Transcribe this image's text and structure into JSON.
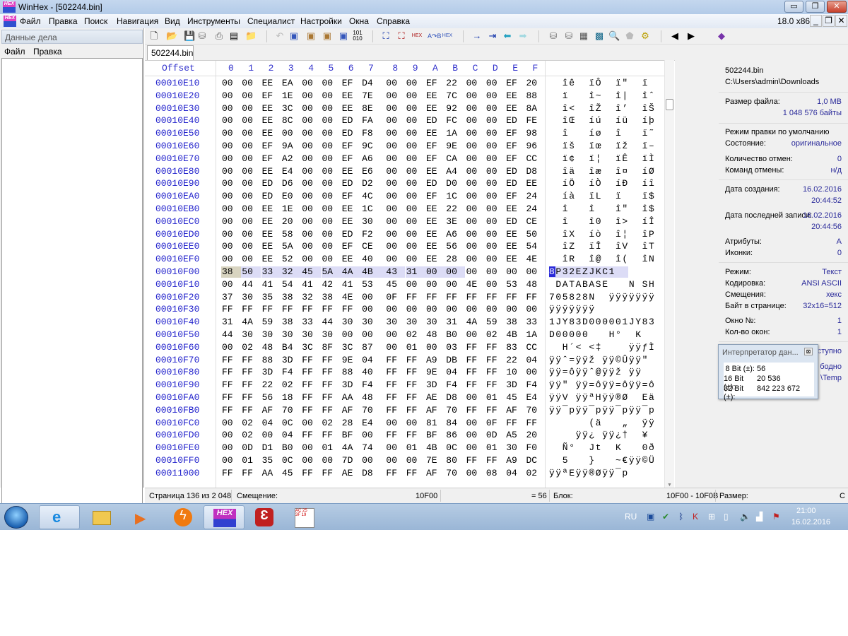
{
  "window": {
    "title": "WinHex - [502244.bin]",
    "version": "18.0 x86"
  },
  "menu": [
    "Файл",
    "Правка",
    "Поиск",
    "Навигация",
    "Вид",
    "Инструменты",
    "Специалист",
    "Настройки",
    "Окна",
    "Справка"
  ],
  "left_panel": {
    "title": "Данные дела",
    "menu": [
      "Файл",
      "Правка"
    ]
  },
  "tab": "502244.bin",
  "hex": {
    "offset_header": "Offset",
    "columns": [
      "0",
      "1",
      "2",
      "3",
      "4",
      "5",
      "6",
      "7",
      "8",
      "9",
      "A",
      "B",
      "C",
      "D",
      "E",
      "F"
    ],
    "rows": [
      {
        "o": "00010E10",
        "h": "00 00 EE EA 00 00 EF D4 00 00 EF 22 00 00 EF 20",
        "t": "  îê  ïÔ  ï\"  ï "
      },
      {
        "o": "00010E20",
        "h": "00 00 EF 1E 00 00 EE 7E 00 00 EE 7C 00 00 EE 88",
        "t": "  ï   î~  î|  îˆ"
      },
      {
        "o": "00010E30",
        "h": "00 00 EE 3C 00 00 EE 8E 00 00 EE 92 00 00 EE 8A",
        "t": "  î<  îŽ  î’  îŠ"
      },
      {
        "o": "00010E40",
        "h": "00 00 EE 8C 00 00 ED FA 00 00 ED FC 00 00 ED FE",
        "t": "  îŒ  íú  íü  íþ"
      },
      {
        "o": "00010E50",
        "h": "00 00 EE 00 00 00 ED F8 00 00 EE 1A 00 00 EF 98",
        "t": "  î   íø  î   ï˜"
      },
      {
        "o": "00010E60",
        "h": "00 00 EF 9A 00 00 EF 9C 00 00 EF 9E 00 00 EF 96",
        "t": "  ïš  ïœ  ïž  ï–"
      },
      {
        "o": "00010E70",
        "h": "00 00 EF A2 00 00 EF A6 00 00 EF CA 00 00 EF CC",
        "t": "  ï¢  ï¦  ïÊ  ïÌ"
      },
      {
        "o": "00010E80",
        "h": "00 00 EE E4 00 00 EE E6 00 00 EE A4 00 00 ED D8",
        "t": "  îä  îæ  î¤  íØ"
      },
      {
        "o": "00010E90",
        "h": "00 00 ED D6 00 00 ED D2 00 00 ED D0 00 00 ED EE",
        "t": "  íÖ  íÒ  íÐ  íî"
      },
      {
        "o": "00010EA0",
        "h": "00 00 ED E0 00 00 EF 4C 00 00 EF 1C 00 00 EF 24",
        "t": "  íà  ïL  ï   ï$"
      },
      {
        "o": "00010EB0",
        "h": "00 00 EE 1E 00 00 EE 1C 00 00 EE 22 00 00 EE 24",
        "t": "  î   î   î\"  î$"
      },
      {
        "o": "00010EC0",
        "h": "00 00 EE 20 00 00 EE 30 00 00 EE 3E 00 00 ED CE",
        "t": "  î   î0  î>  íÎ"
      },
      {
        "o": "00010ED0",
        "h": "00 00 EE 58 00 00 ED F2 00 00 EE A6 00 00 EE 50",
        "t": "  îX  íò  î¦  îP"
      },
      {
        "o": "00010EE0",
        "h": "00 00 EE 5A 00 00 EF CE 00 00 EE 56 00 00 EE 54",
        "t": "  îZ  ïÎ  îV  îT"
      },
      {
        "o": "00010EF0",
        "h": "00 00 EE 52 00 00 EE 40 00 00 EE 28 00 00 EE 4E",
        "t": "  îR  î@  î(  îN"
      },
      {
        "o": "00010F00",
        "h": "38 50 33 32 45 5A 4A 4B 43 31 00 00 00 00 00 00",
        "t": "8P32EZJKC1      "
      },
      {
        "o": "00010F10",
        "h": "00 44 41 54 41 42 41 53 45 00 00 00 4E 00 53 48",
        "t": " DATABASE   N SH"
      },
      {
        "o": "00010F20",
        "h": "37 30 35 38 32 38 4E 00 0F FF FF FF FF FF FF FF",
        "t": "705828N  ÿÿÿÿÿÿÿ"
      },
      {
        "o": "00010F30",
        "h": "FF FF FF FF FF FF FF 00 00 00 00 00 00 00 00 00",
        "t": "ÿÿÿÿÿÿÿ         "
      },
      {
        "o": "00010F40",
        "h": "31 4A 59 38 33 44 30 30 30 30 30 31 4A 59 38 33",
        "t": "1JY83D000001JY83"
      },
      {
        "o": "00010F50",
        "h": "44 30 30 30 30 30 00 00 00 02 48 B0 00 02 4B 1A",
        "t": "D00000   H°  K "
      },
      {
        "o": "00010F60",
        "h": "00 02 48 B4 3C 8F 3C 87 00 01 00 03 FF FF 83 CC",
        "t": "  H´< <‡    ÿÿƒÌ"
      },
      {
        "o": "00010F70",
        "h": "FF FF 88 3D FF FF 9E 04 FF FF A9 DB FF FF 22 04",
        "t": "ÿÿˆ=ÿÿž ÿÿ©Ûÿÿ\" "
      },
      {
        "o": "00010F80",
        "h": "FF FF 3D F4 FF FF 88 40 FF FF 9E 04 FF FF 10 00",
        "t": "ÿÿ=ôÿÿˆ@ÿÿž ÿÿ  "
      },
      {
        "o": "00010F90",
        "h": "FF FF 22 02 FF FF 3D F4 FF FF 3D F4 FF FF 3D F4",
        "t": "ÿÿ\" ÿÿ=ôÿÿ=ôÿÿ=ô"
      },
      {
        "o": "00010FA0",
        "h": "FF FF 56 18 FF FF AA 48 FF FF AE D8 00 01 45 E4",
        "t": "ÿÿV ÿÿªHÿÿ®Ø  Eä"
      },
      {
        "o": "00010FB0",
        "h": "FF FF AF 70 FF FF AF 70 FF FF AF 70 FF FF AF 70",
        "t": "ÿÿ¯pÿÿ¯pÿÿ¯pÿÿ¯p"
      },
      {
        "o": "00010FC0",
        "h": "00 02 04 0C 00 02 28 E4 00 00 81 84 00 0F FF FF",
        "t": "      (ä   „  ÿÿ"
      },
      {
        "o": "00010FD0",
        "h": "00 02 00 04 FF FF BF 00 FF FF BF 86 00 0D A5 20",
        "t": "    ÿÿ¿ ÿÿ¿†  ¥ "
      },
      {
        "o": "00010FE0",
        "h": "00 0D D1 B0 00 01 4A 74 00 01 4B 0C 00 01 30 F0",
        "t": "  Ñ°  Jt  K   0ð"
      },
      {
        "o": "00010FF0",
        "h": "00 01 35 0C 00 00 7D 00 00 00 7E 80 FF FF A9 DC",
        "t": "  5   }   ~€ÿÿ©Ü"
      },
      {
        "o": "00011000",
        "h": "FF FF AA 45 FF FF AE D8 FF FF AF 70 00 08 04 02",
        "t": "ÿÿªEÿÿ®Øÿÿ¯p    "
      }
    ],
    "selection": {
      "row_offset": "00010F00",
      "start_byte": 0,
      "length": 12
    }
  },
  "info": {
    "file_name": "502244.bin",
    "path": "C:\\Users\\admin\\Downloads",
    "size_label": "Размер файла:",
    "size_value": "1,0 MB",
    "size_bytes": "1 048 576 байты",
    "edit_mode": "Режим правки по умолчанию",
    "state_label": "Состояние:",
    "state_value": "оригинальное",
    "undo_count_label": "Количество отмен:",
    "undo_count_value": "0",
    "undo_cmd_label": "Команд отмены:",
    "undo_cmd_value": "н/д",
    "created_label": "Дата создания:",
    "created_date": "16.02.2016",
    "created_time": "20:44:52",
    "modified_label": "Дата последней записи:",
    "modified_date": "16.02.2016",
    "modified_time": "20:44:56",
    "attr_label": "Атрибуты:",
    "attr_value": "A",
    "icons_label": "Иконки:",
    "icons_value": "0",
    "mode_label": "Режим:",
    "mode_value": "Текст",
    "encoding_label": "Кодировка:",
    "encoding_value": "ANSI ASCII",
    "offsets_label": "Смещения:",
    "offsets_value": "хекс",
    "bpp_label": "Байт в странице:",
    "bpp_value": "32x16=512",
    "window_no_label": "Окно №:",
    "window_no_value": "1",
    "windows_label": "Кол-во окон:",
    "windows_value": "1",
    "hidden1": "ступно",
    "hidden2": "бодно",
    "hidden3": "\\Temp"
  },
  "interpreter": {
    "title": "Интерпретатор дан...",
    "rows": [
      {
        "label": "8 Bit (±):",
        "value": "56"
      },
      {
        "label": "16 Bit (±):",
        "value": "20 536"
      },
      {
        "label": "32 Bit (±):",
        "value": "842 223 672"
      }
    ]
  },
  "status": {
    "page": "Страница 136 из 2 048",
    "offset_label": "Смещение:",
    "offset_value": "10F00",
    "value": "= 56",
    "block_label": "Блок:",
    "block_value": "10F00 - 10F0B",
    "size_label": "Размер:",
    "size_value": "C"
  },
  "taskbar": {
    "lang": "RU",
    "time": "21:00",
    "date": "16.02.2016"
  }
}
